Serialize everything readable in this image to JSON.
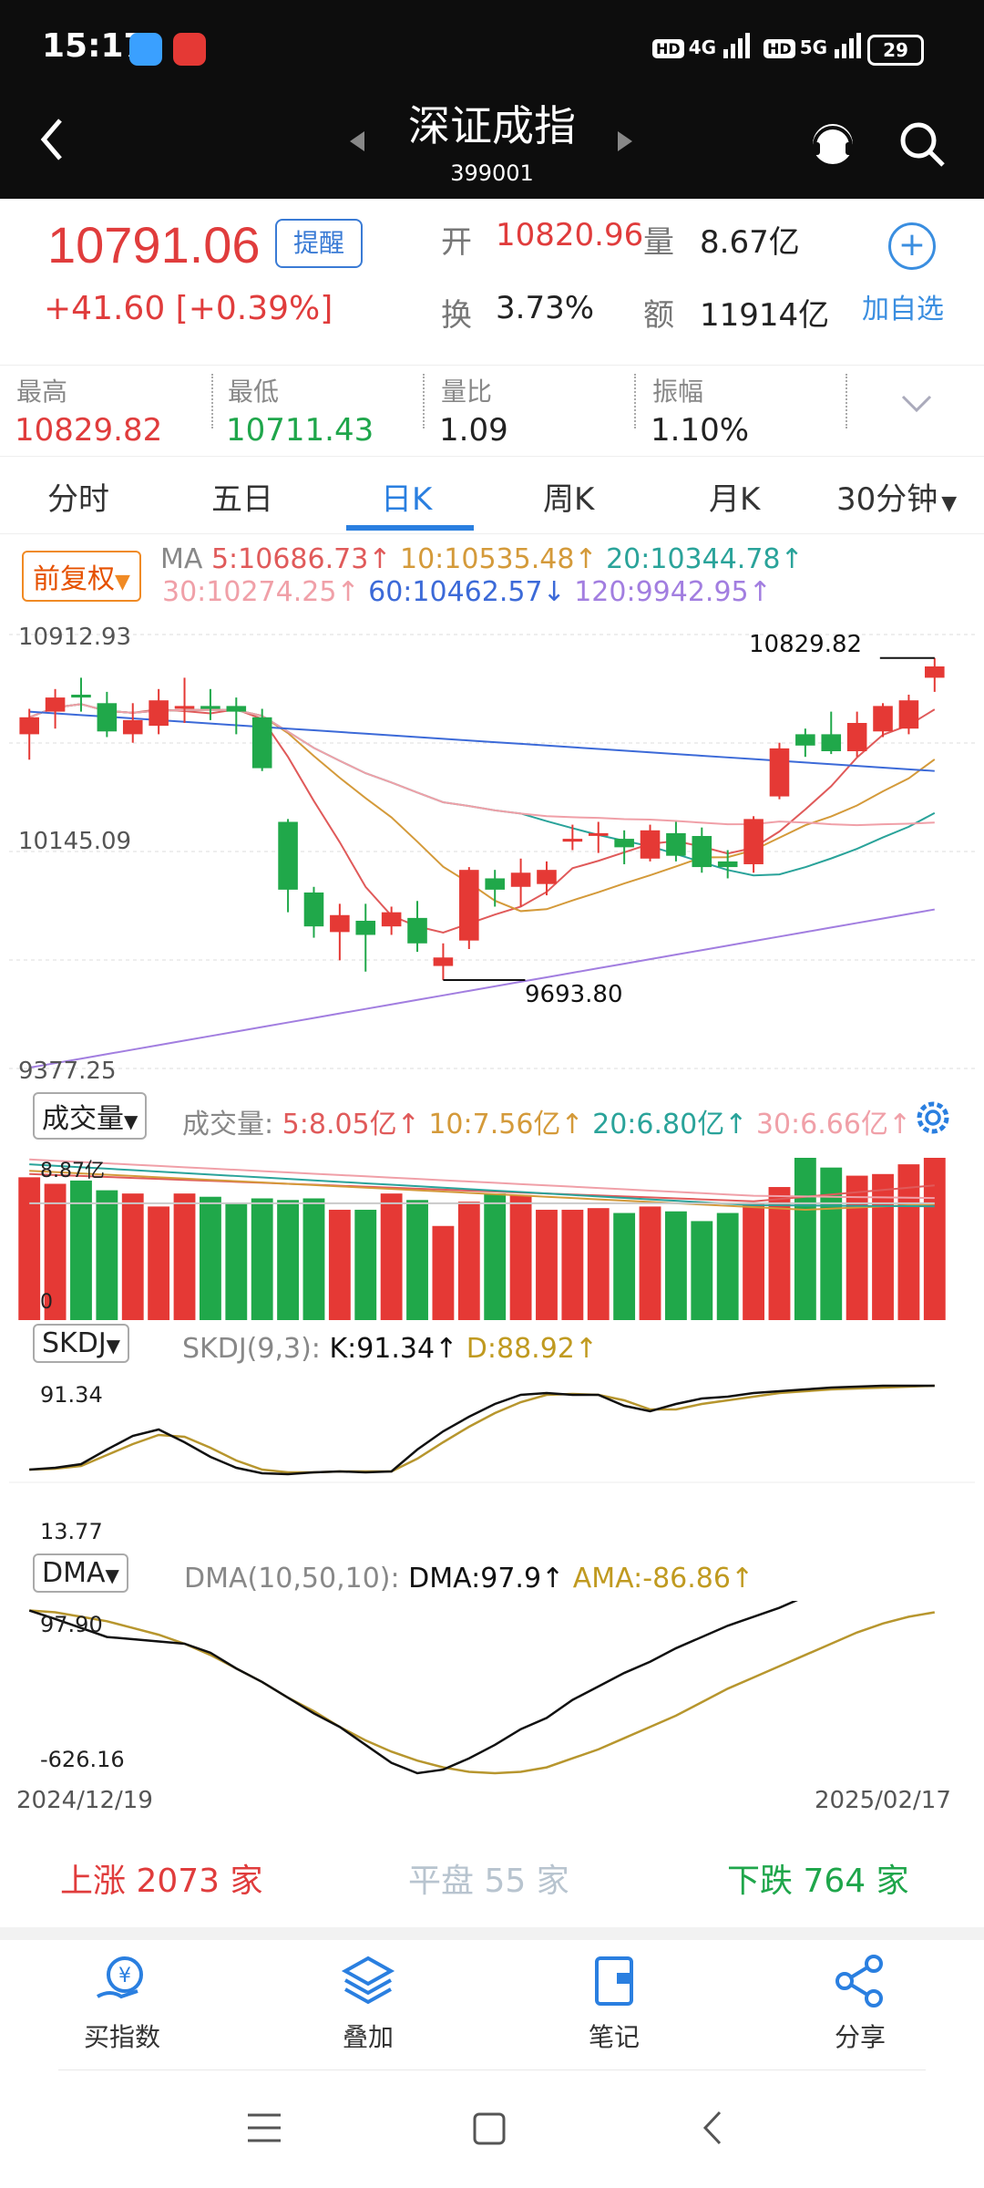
{
  "status_bar": {
    "time": "15:17",
    "battery": "29",
    "net1": "4G",
    "net2": "5G",
    "hd": "HD"
  },
  "header": {
    "title": "深证成指",
    "code": "399001"
  },
  "quote": {
    "price": "10791.06",
    "change": "+41.60 [+0.39%]",
    "remind_label": "提醒",
    "open_label": "开",
    "open_value": "10820.96",
    "volume_label": "量",
    "volume_value": "8.67亿",
    "turnover_label": "换",
    "turnover_value": "3.73%",
    "amount_label": "额",
    "amount_value": "11914亿",
    "add_fav_label": "加自选"
  },
  "stats": [
    {
      "label": "最高",
      "value": "10829.82"
    },
    {
      "label": "最低",
      "value": "10711.43"
    },
    {
      "label": "量比",
      "value": "1.09"
    },
    {
      "label": "振幅",
      "value": "1.10%"
    }
  ],
  "tabs": [
    "分时",
    "五日",
    "日K",
    "周K",
    "月K",
    "30分钟"
  ],
  "active_tab": "日K",
  "ma_panel": {
    "adjust_label": "前复权",
    "ma_label": "MA",
    "ma5": "5:10686.73↑",
    "ma10": "10:10535.48↑",
    "ma20": "20:10344.78↑",
    "ma30": "30:10274.25↑",
    "ma60": "60:10462.57↓",
    "ma120": "120:9942.95↑"
  },
  "price_axis": {
    "top": "10912.93",
    "mid": "10145.09",
    "bottom": "9377.25",
    "high_mark": "10829.82",
    "low_mark": "9693.80"
  },
  "volume_panel": {
    "selector": "成交量",
    "label": "成交量:",
    "v5": "5:8.05亿↑",
    "v10": "10:7.56亿↑",
    "v20": "20:6.80亿↑",
    "v30": "30:6.66亿↑",
    "max": "8.87亿",
    "min": "0"
  },
  "skdj_panel": {
    "selector": "SKDJ",
    "params": "SKDJ(9,3):",
    "k": "K:91.34↑",
    "d": "D:88.92↑",
    "top": "91.34",
    "bottom": "13.77"
  },
  "dma_panel": {
    "selector": "DMA",
    "params": "DMA(10,50,10):",
    "dma": "DMA:97.9↑",
    "ama": "AMA:-86.86↑",
    "top": "97.90",
    "bottom": "-626.16"
  },
  "dates": {
    "start": "2024/12/19",
    "end": "2025/02/17"
  },
  "breadth": {
    "up": "上涨 2073 家",
    "flat": "平盘 55 家",
    "down": "下跌 764 家"
  },
  "bottom_nav": [
    "买指数",
    "叠加",
    "笔记",
    "分享"
  ],
  "colors": {
    "up": "#e53935",
    "down": "#20a84a",
    "accent": "#2a7fe0",
    "ma5": "#e05a5a",
    "ma10": "#d49a3a",
    "ma20": "#2aa39a",
    "ma30": "#f0a0a8",
    "ma60": "#3c6ad8",
    "ma120": "#a27ee0"
  },
  "chart_data": {
    "type": "candlestick",
    "ylim": [
      9377.25,
      10912.93
    ],
    "candles": [
      {
        "o": 10560,
        "c": 10620,
        "h": 10650,
        "l": 10470
      },
      {
        "o": 10640,
        "c": 10690,
        "h": 10720,
        "l": 10580
      },
      {
        "o": 10700,
        "c": 10690,
        "h": 10760,
        "l": 10640
      },
      {
        "o": 10670,
        "c": 10570,
        "h": 10710,
        "l": 10550
      },
      {
        "o": 10560,
        "c": 10610,
        "h": 10670,
        "l": 10530
      },
      {
        "o": 10590,
        "c": 10680,
        "h": 10720,
        "l": 10560
      },
      {
        "o": 10650,
        "c": 10660,
        "h": 10760,
        "l": 10600
      },
      {
        "o": 10660,
        "c": 10650,
        "h": 10720,
        "l": 10610
      },
      {
        "o": 10660,
        "c": 10640,
        "h": 10690,
        "l": 10560
      },
      {
        "o": 10620,
        "c": 10440,
        "h": 10650,
        "l": 10430
      },
      {
        "o": 10250,
        "c": 10010,
        "h": 10260,
        "l": 9930
      },
      {
        "o": 10000,
        "c": 9880,
        "h": 10020,
        "l": 9840
      },
      {
        "o": 9860,
        "c": 9920,
        "h": 9960,
        "l": 9760
      },
      {
        "o": 9900,
        "c": 9850,
        "h": 9960,
        "l": 9720
      },
      {
        "o": 9880,
        "c": 9930,
        "h": 9950,
        "l": 9850
      },
      {
        "o": 9910,
        "c": 9820,
        "h": 9970,
        "l": 9790
      },
      {
        "o": 9740,
        "c": 9770,
        "h": 9820,
        "l": 9690
      },
      {
        "o": 9830,
        "c": 10080,
        "h": 10090,
        "l": 9800
      },
      {
        "o": 10050,
        "c": 10010,
        "h": 10080,
        "l": 9950
      },
      {
        "o": 10020,
        "c": 10070,
        "h": 10120,
        "l": 9950
      },
      {
        "o": 10030,
        "c": 10080,
        "h": 10110,
        "l": 9990
      },
      {
        "o": 10180,
        "c": 10190,
        "h": 10240,
        "l": 10150
      },
      {
        "o": 10210,
        "c": 10210,
        "h": 10250,
        "l": 10140
      },
      {
        "o": 10190,
        "c": 10160,
        "h": 10220,
        "l": 10100
      },
      {
        "o": 10120,
        "c": 10220,
        "h": 10240,
        "l": 10110
      },
      {
        "o": 10210,
        "c": 10130,
        "h": 10250,
        "l": 10110
      },
      {
        "o": 10200,
        "c": 10090,
        "h": 10230,
        "l": 10070
      },
      {
        "o": 10110,
        "c": 10090,
        "h": 10150,
        "l": 10050
      },
      {
        "o": 10100,
        "c": 10260,
        "h": 10270,
        "l": 10070
      },
      {
        "o": 10340,
        "c": 10510,
        "h": 10530,
        "l": 10330
      },
      {
        "o": 10560,
        "c": 10520,
        "h": 10580,
        "l": 10480
      },
      {
        "o": 10560,
        "c": 10500,
        "h": 10640,
        "l": 10490
      },
      {
        "o": 10500,
        "c": 10600,
        "h": 10640,
        "l": 10480
      },
      {
        "o": 10570,
        "c": 10660,
        "h": 10670,
        "l": 10550
      },
      {
        "o": 10580,
        "c": 10680,
        "h": 10700,
        "l": 10560
      },
      {
        "o": 10760,
        "c": 10800,
        "h": 10830,
        "l": 10710
      }
    ]
  }
}
